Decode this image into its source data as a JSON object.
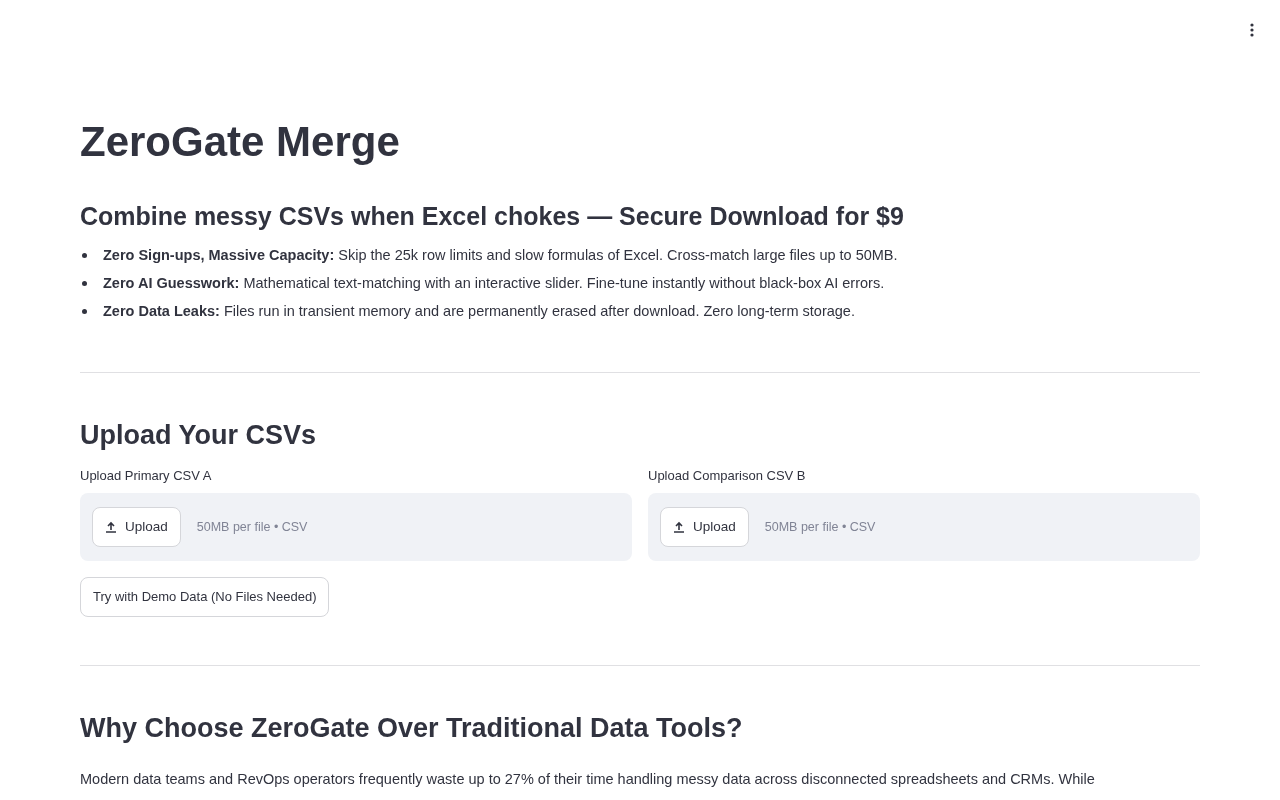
{
  "title": "ZeroGate Merge",
  "subtitle": "Combine messy CSVs when Excel chokes — Secure Download for $9",
  "features": [
    "**Zero Sign-ups, Massive Capacity:** Skip the 25k row limits and slow formulas of Excel. Cross-match large files up to 50MB.",
    "**Zero AI Guesswork:** Mathematical text-matching with an interactive slider. Fine-tune instantly without black-box AI errors.",
    "**Zero Data Leaks:** Files run in transient memory and are permanently erased after download. Zero long-term storage."
  ],
  "upload_section": {
    "heading": "Upload Your CSVs",
    "uploaders": [
      {
        "label": "Upload Primary CSV A",
        "button": "Upload",
        "hint": "50MB per file • CSV"
      },
      {
        "label": "Upload Comparison CSV B",
        "button": "Upload",
        "hint": "50MB per file • CSV"
      }
    ],
    "demo_button": "Try with Demo Data (No Files Needed)"
  },
  "why_section": {
    "heading": "Why Choose ZeroGate Over Traditional Data Tools?",
    "paragraph": "Modern data teams and RevOps operators frequently waste up to 27% of their time handling messy data across disconnected spreadsheets and CRMs. While"
  }
}
